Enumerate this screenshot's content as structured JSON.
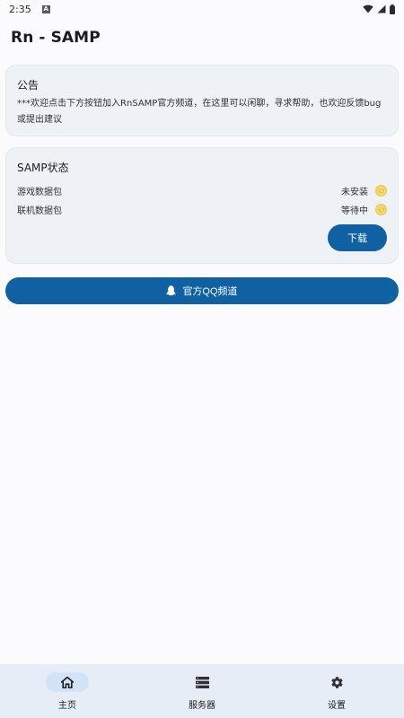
{
  "status_bar": {
    "time": "2:35",
    "notification_icon": "a-icon"
  },
  "app": {
    "title": "Rn - SAMP"
  },
  "notice": {
    "title": "公告",
    "text": "***欢迎点击下方按钮加入RnSAMP官方频道，在这里可以闲聊，寻求帮助，也欢迎反馈bug或提出建议"
  },
  "samp_status": {
    "title": "SAMP状态",
    "rows": [
      {
        "label": "游戏数据包",
        "value": "未安装",
        "icon": "clock-icon"
      },
      {
        "label": "联机数据包",
        "value": "等待中",
        "icon": "clock-icon"
      }
    ],
    "download_label": "下载"
  },
  "qq_button": {
    "label": "官方QQ频道",
    "icon": "qq-icon"
  },
  "nav": {
    "items": [
      {
        "label": "主页",
        "icon": "home-icon",
        "active": true
      },
      {
        "label": "服务器",
        "icon": "server-icon",
        "active": false
      },
      {
        "label": "设置",
        "icon": "gear-icon",
        "active": false
      }
    ]
  },
  "colors": {
    "primary": "#0f61a4",
    "card_bg": "#eef1f6",
    "nav_bg": "#e7edf6",
    "nav_active_pill": "#d2e3f7",
    "status_icon": "#f2c94c"
  }
}
